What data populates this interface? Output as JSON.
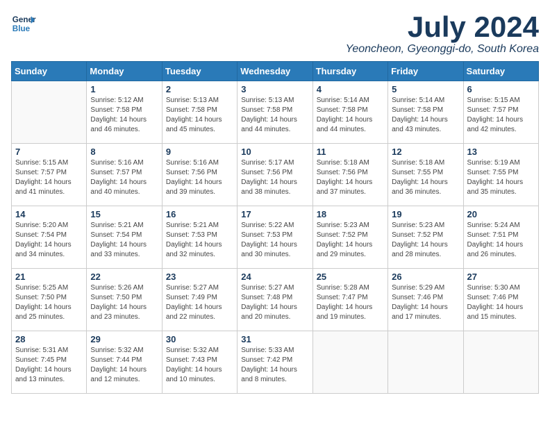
{
  "header": {
    "logo_line1": "General",
    "logo_line2": "Blue",
    "month": "July 2024",
    "location": "Yeoncheon, Gyeonggi-do, South Korea"
  },
  "weekdays": [
    "Sunday",
    "Monday",
    "Tuesday",
    "Wednesday",
    "Thursday",
    "Friday",
    "Saturday"
  ],
  "weeks": [
    [
      {
        "day": "",
        "info": ""
      },
      {
        "day": "1",
        "info": "Sunrise: 5:12 AM\nSunset: 7:58 PM\nDaylight: 14 hours\nand 46 minutes."
      },
      {
        "day": "2",
        "info": "Sunrise: 5:13 AM\nSunset: 7:58 PM\nDaylight: 14 hours\nand 45 minutes."
      },
      {
        "day": "3",
        "info": "Sunrise: 5:13 AM\nSunset: 7:58 PM\nDaylight: 14 hours\nand 44 minutes."
      },
      {
        "day": "4",
        "info": "Sunrise: 5:14 AM\nSunset: 7:58 PM\nDaylight: 14 hours\nand 44 minutes."
      },
      {
        "day": "5",
        "info": "Sunrise: 5:14 AM\nSunset: 7:58 PM\nDaylight: 14 hours\nand 43 minutes."
      },
      {
        "day": "6",
        "info": "Sunrise: 5:15 AM\nSunset: 7:57 PM\nDaylight: 14 hours\nand 42 minutes."
      }
    ],
    [
      {
        "day": "7",
        "info": "Sunrise: 5:15 AM\nSunset: 7:57 PM\nDaylight: 14 hours\nand 41 minutes."
      },
      {
        "day": "8",
        "info": "Sunrise: 5:16 AM\nSunset: 7:57 PM\nDaylight: 14 hours\nand 40 minutes."
      },
      {
        "day": "9",
        "info": "Sunrise: 5:16 AM\nSunset: 7:56 PM\nDaylight: 14 hours\nand 39 minutes."
      },
      {
        "day": "10",
        "info": "Sunrise: 5:17 AM\nSunset: 7:56 PM\nDaylight: 14 hours\nand 38 minutes."
      },
      {
        "day": "11",
        "info": "Sunrise: 5:18 AM\nSunset: 7:56 PM\nDaylight: 14 hours\nand 37 minutes."
      },
      {
        "day": "12",
        "info": "Sunrise: 5:18 AM\nSunset: 7:55 PM\nDaylight: 14 hours\nand 36 minutes."
      },
      {
        "day": "13",
        "info": "Sunrise: 5:19 AM\nSunset: 7:55 PM\nDaylight: 14 hours\nand 35 minutes."
      }
    ],
    [
      {
        "day": "14",
        "info": "Sunrise: 5:20 AM\nSunset: 7:54 PM\nDaylight: 14 hours\nand 34 minutes."
      },
      {
        "day": "15",
        "info": "Sunrise: 5:21 AM\nSunset: 7:54 PM\nDaylight: 14 hours\nand 33 minutes."
      },
      {
        "day": "16",
        "info": "Sunrise: 5:21 AM\nSunset: 7:53 PM\nDaylight: 14 hours\nand 32 minutes."
      },
      {
        "day": "17",
        "info": "Sunrise: 5:22 AM\nSunset: 7:53 PM\nDaylight: 14 hours\nand 30 minutes."
      },
      {
        "day": "18",
        "info": "Sunrise: 5:23 AM\nSunset: 7:52 PM\nDaylight: 14 hours\nand 29 minutes."
      },
      {
        "day": "19",
        "info": "Sunrise: 5:23 AM\nSunset: 7:52 PM\nDaylight: 14 hours\nand 28 minutes."
      },
      {
        "day": "20",
        "info": "Sunrise: 5:24 AM\nSunset: 7:51 PM\nDaylight: 14 hours\nand 26 minutes."
      }
    ],
    [
      {
        "day": "21",
        "info": "Sunrise: 5:25 AM\nSunset: 7:50 PM\nDaylight: 14 hours\nand 25 minutes."
      },
      {
        "day": "22",
        "info": "Sunrise: 5:26 AM\nSunset: 7:50 PM\nDaylight: 14 hours\nand 23 minutes."
      },
      {
        "day": "23",
        "info": "Sunrise: 5:27 AM\nSunset: 7:49 PM\nDaylight: 14 hours\nand 22 minutes."
      },
      {
        "day": "24",
        "info": "Sunrise: 5:27 AM\nSunset: 7:48 PM\nDaylight: 14 hours\nand 20 minutes."
      },
      {
        "day": "25",
        "info": "Sunrise: 5:28 AM\nSunset: 7:47 PM\nDaylight: 14 hours\nand 19 minutes."
      },
      {
        "day": "26",
        "info": "Sunrise: 5:29 AM\nSunset: 7:46 PM\nDaylight: 14 hours\nand 17 minutes."
      },
      {
        "day": "27",
        "info": "Sunrise: 5:30 AM\nSunset: 7:46 PM\nDaylight: 14 hours\nand 15 minutes."
      }
    ],
    [
      {
        "day": "28",
        "info": "Sunrise: 5:31 AM\nSunset: 7:45 PM\nDaylight: 14 hours\nand 13 minutes."
      },
      {
        "day": "29",
        "info": "Sunrise: 5:32 AM\nSunset: 7:44 PM\nDaylight: 14 hours\nand 12 minutes."
      },
      {
        "day": "30",
        "info": "Sunrise: 5:32 AM\nSunset: 7:43 PM\nDaylight: 14 hours\nand 10 minutes."
      },
      {
        "day": "31",
        "info": "Sunrise: 5:33 AM\nSunset: 7:42 PM\nDaylight: 14 hours\nand 8 minutes."
      },
      {
        "day": "",
        "info": ""
      },
      {
        "day": "",
        "info": ""
      },
      {
        "day": "",
        "info": ""
      }
    ]
  ]
}
